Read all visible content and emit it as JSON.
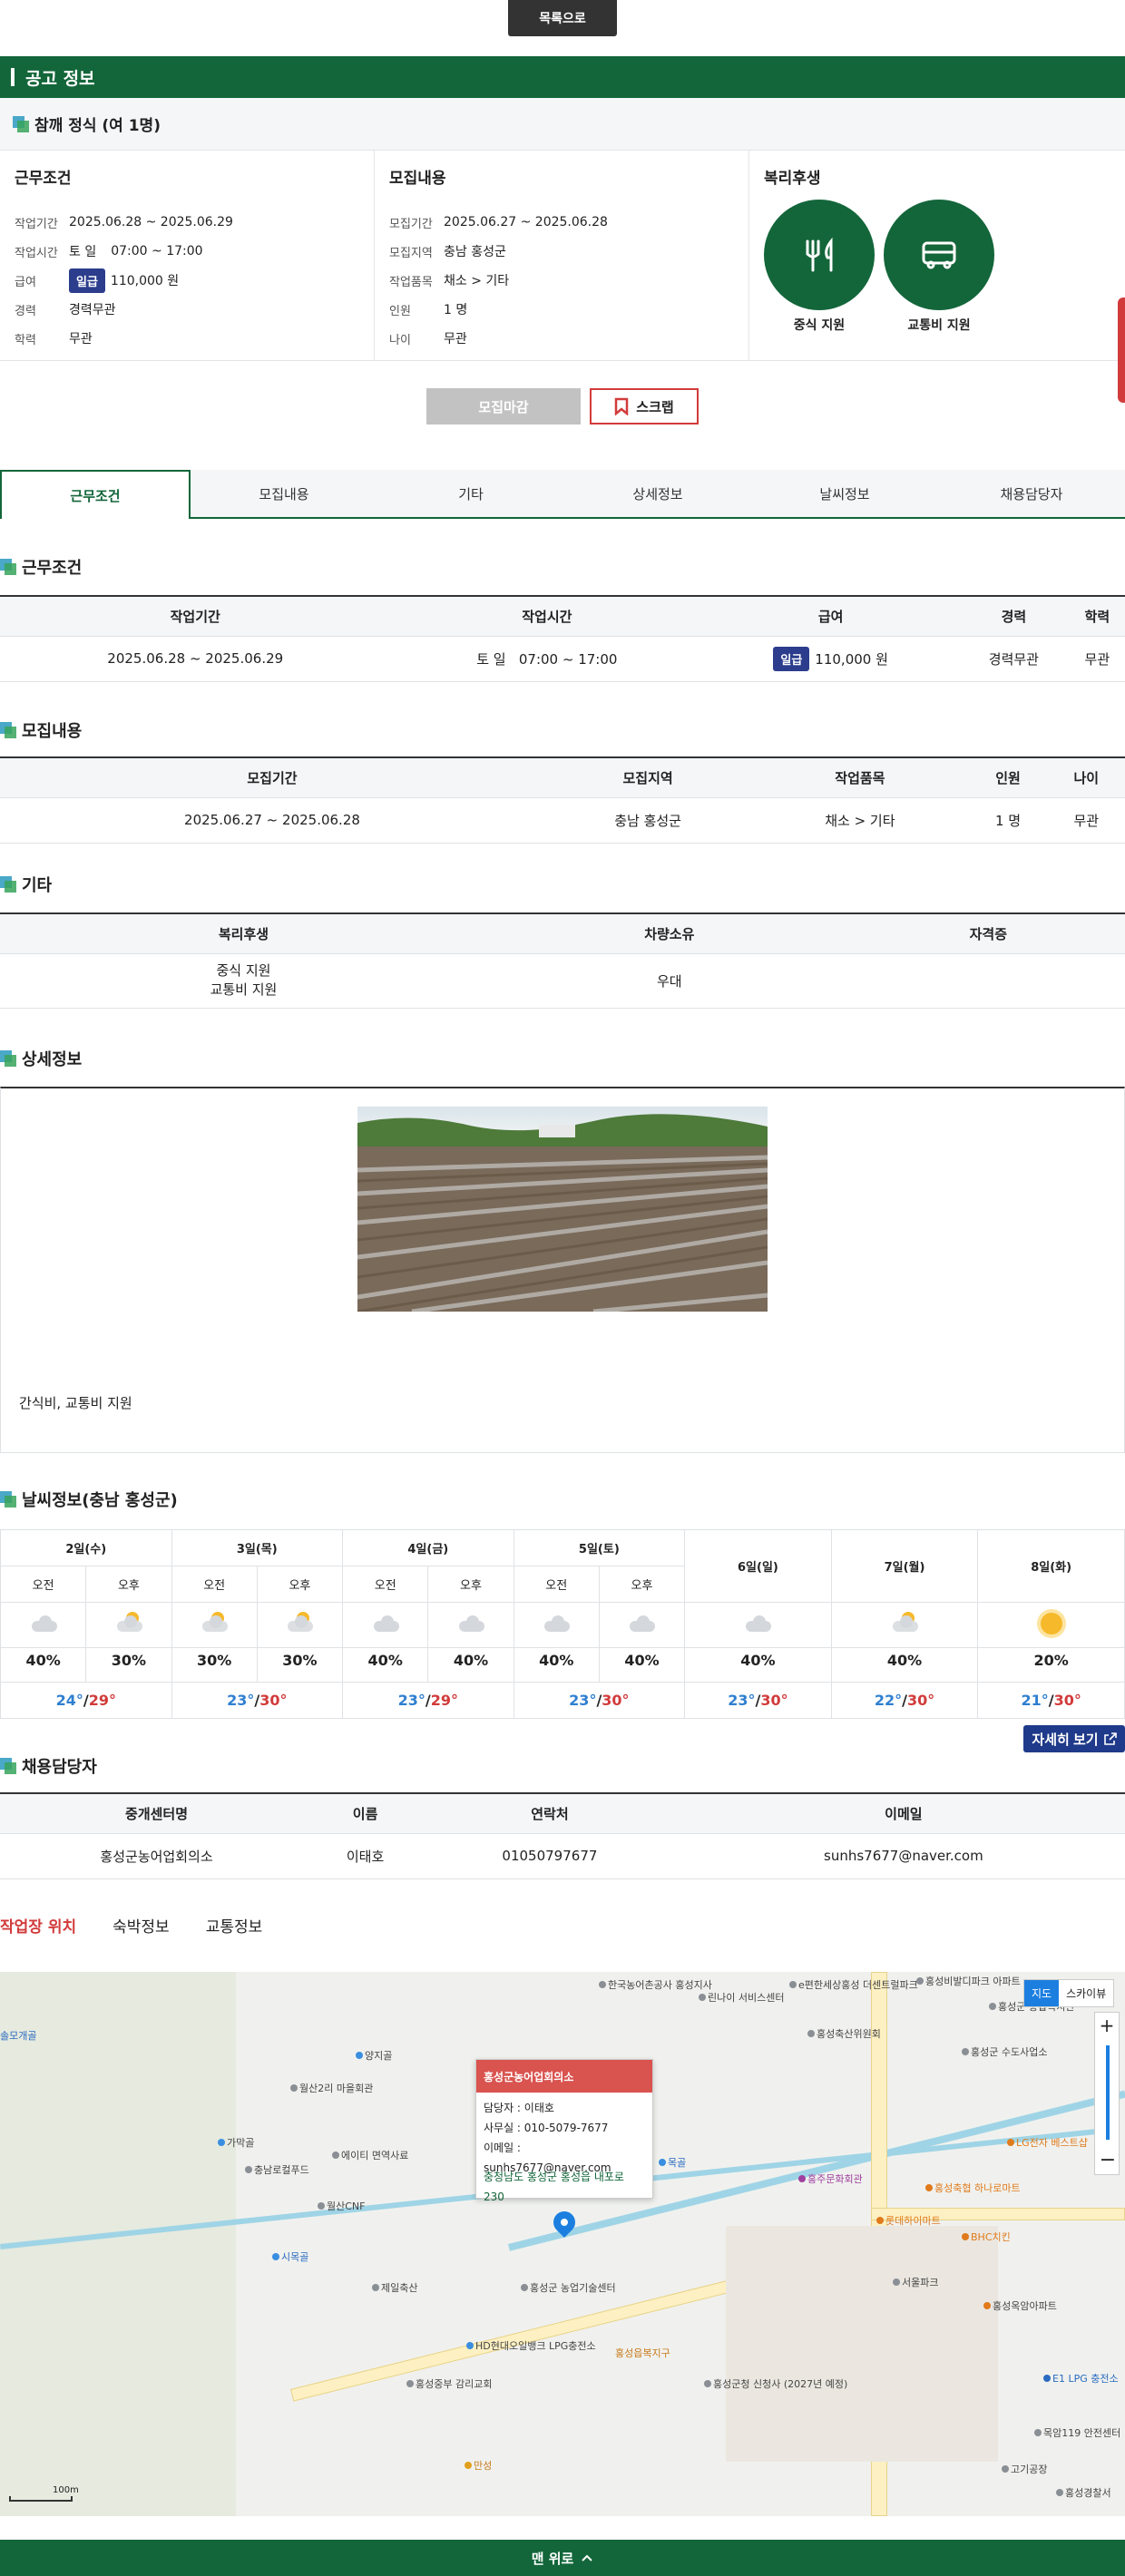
{
  "top": {
    "list_button": "목록으로"
  },
  "header": {
    "title": "공고 정보"
  },
  "job": {
    "title": "참깨 정식 (여 1명)"
  },
  "cards": {
    "work": {
      "title": "근무조건",
      "period_k": "작업기간",
      "period_v": "2025.06.28 ~ 2025.06.29",
      "time_k": "작업시간",
      "time_days": "토 일",
      "time_hours": "07:00 ~ 17:00",
      "pay_k": "급여",
      "pay_badge": "일급",
      "pay_v": "110,000 원",
      "career_k": "경력",
      "career_v": "경력무관",
      "edu_k": "학력",
      "edu_v": "무관"
    },
    "recruit": {
      "title": "모집내용",
      "period_k": "모집기간",
      "period_v": "2025.06.27 ~ 2025.06.28",
      "area_k": "모집지역",
      "area_v": "충남 홍성군",
      "item_k": "작업품목",
      "item_v": "채소 > 기타",
      "count_k": "인원",
      "count_v": "1 명",
      "age_k": "나이",
      "age_v": "무관"
    },
    "welfare": {
      "title": "복리후생",
      "meal": "중식 지원",
      "transport": "교통비 지원"
    }
  },
  "actions": {
    "closed": "모집마감",
    "scrap": "스크랩"
  },
  "tabs": [
    "근무조건",
    "모집내용",
    "기타",
    "상세정보",
    "날씨정보",
    "채용담당자"
  ],
  "sections": {
    "work": {
      "title": "근무조건",
      "headers": [
        "작업기간",
        "작업시간",
        "급여",
        "경력",
        "학력"
      ],
      "period": "2025.06.28 ~ 2025.06.29",
      "days": "토 일",
      "hours": "07:00 ~ 17:00",
      "pay_badge": "일급",
      "pay": "110,000 원",
      "career": "경력무관",
      "edu": "무관"
    },
    "recruit": {
      "title": "모집내용",
      "headers": [
        "모집기간",
        "모집지역",
        "작업품목",
        "인원",
        "나이"
      ],
      "row": [
        "2025.06.27 ~ 2025.06.28",
        "충남 홍성군",
        "채소 > 기타",
        "1 명",
        "무관"
      ]
    },
    "etc": {
      "title": "기타",
      "headers": [
        "복리후생",
        "차량소유",
        "자격증"
      ],
      "welfare1": "중식 지원",
      "welfare2": "교통비 지원",
      "vehicle": "우대",
      "license": ""
    },
    "detail": {
      "title": "상세정보",
      "text": "간식비, 교통비 지원"
    },
    "weather": {
      "title": "날씨정보(충남 홍성군)",
      "days": [
        "2일(수)",
        "3일(목)",
        "4일(금)",
        "5일(토)",
        "6일(일)",
        "7일(월)",
        "8일(화)"
      ],
      "am": "오전",
      "pm": "오후",
      "pct": [
        "40%",
        "30%",
        "30%",
        "30%",
        "40%",
        "40%",
        "40%",
        "40%",
        "40%",
        "40%",
        "20%"
      ],
      "icons": [
        "cloud",
        "sun-cloud",
        "sun-cloud",
        "sun-cloud",
        "cloud",
        "cloud",
        "cloud",
        "cloud",
        "cloud",
        "sun-cloud",
        "sun"
      ],
      "temps": [
        {
          "lo": "24°",
          "hi": "29°"
        },
        {
          "lo": "23°",
          "hi": "30°"
        },
        {
          "lo": "23°",
          "hi": "29°"
        },
        {
          "lo": "23°",
          "hi": "30°"
        },
        {
          "lo": "23°",
          "hi": "30°"
        },
        {
          "lo": "22°",
          "hi": "30°"
        },
        {
          "lo": "21°",
          "hi": "30°"
        }
      ],
      "more": "자세히 보기"
    },
    "contact": {
      "title": "채용담당자",
      "headers": [
        "중개센터명",
        "이름",
        "연락처",
        "이메일"
      ],
      "row": [
        "홍성군농어업회의소",
        "이태호",
        "01050797677",
        "sunhs7677@naver.com"
      ]
    }
  },
  "location_tabs": [
    "작업장 위치",
    "숙박정보",
    "교통정보"
  ],
  "map": {
    "popup_title": "홍성군농어업회의소",
    "popup_manager": "담당자 : 이태호",
    "popup_phone": "사무실 : 010-5079-7677",
    "popup_email": "이메일 : sunhs7677@naver.com",
    "popup_addr": "충청남도 홍성군 홍성읍 내포로 230",
    "type_map": "지도",
    "type_sky": "스카이뷰",
    "scale": "100m",
    "pois": [
      "한국농어촌공사 홍성지사",
      "린나이 서비스센터",
      "e편한세상홍성 더센트럴파크",
      "홍성비발디파크 아파트",
      "홍성축산위원회",
      "홍성군 종합복지관",
      "홍성군 수도사업소",
      "월산2리 마을회관",
      "양지골",
      "에이티 면역사료",
      "충남로컬푸드",
      "월산CNF",
      "가막골",
      "제일축산",
      "홍성군 농업기술센터",
      "HD현대오일뱅크 LPG충전소",
      "홍성중부 감리교회",
      "홍성군청 신청사 (2027년 예정)",
      "홍성읍복지구",
      "홍주문화회관",
      "홍성축협 하나로마트",
      "롯데하이마트",
      "BHC치킨",
      "LG전자 베스트샵",
      "서울파크",
      "홍성옥암아파트",
      "E1 LPG 충전소",
      "목암119 안전센터",
      "고기공장",
      "홍성경찰서",
      "만성",
      "시목골",
      "솔모개골",
      "목골"
    ]
  },
  "footer": {
    "top_button": "맨 위로"
  }
}
